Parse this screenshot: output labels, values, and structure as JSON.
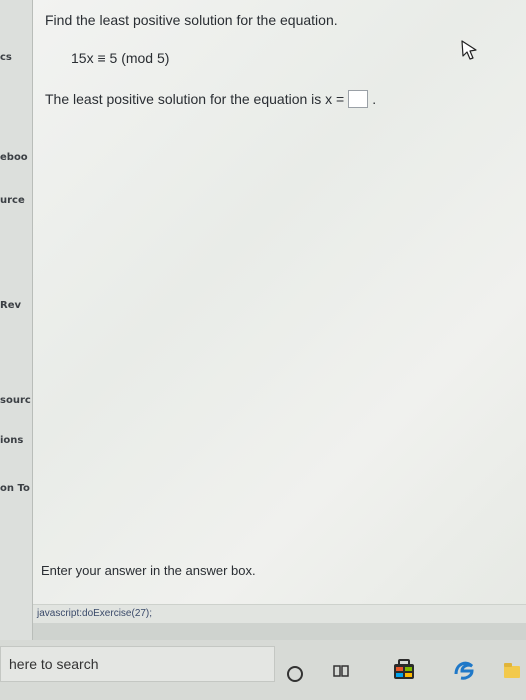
{
  "sidebar": {
    "items": [
      {
        "label": "cs"
      },
      {
        "label": "eboo"
      },
      {
        "label": "urce"
      },
      {
        "label": "Rev"
      },
      {
        "label": "sourc"
      },
      {
        "label": "ions"
      },
      {
        "label": "on To"
      }
    ]
  },
  "question": {
    "title": "Find the least positive solution for the equation.",
    "equation": "15x ≡ 5 (mod 5)",
    "answer_prefix": "The least positive solution for the equation is x =",
    "answer_value": "",
    "answer_suffix": ".",
    "hint": "Enter your answer in the answer box."
  },
  "status_link": "javascript:doExercise(27);",
  "taskbar": {
    "search_placeholder": "here to search"
  },
  "colors": {
    "panel": "#f0f1ee",
    "sidebar": "#dcdfdc",
    "taskbar": "#d7dad6",
    "text": "#2a2e33"
  }
}
